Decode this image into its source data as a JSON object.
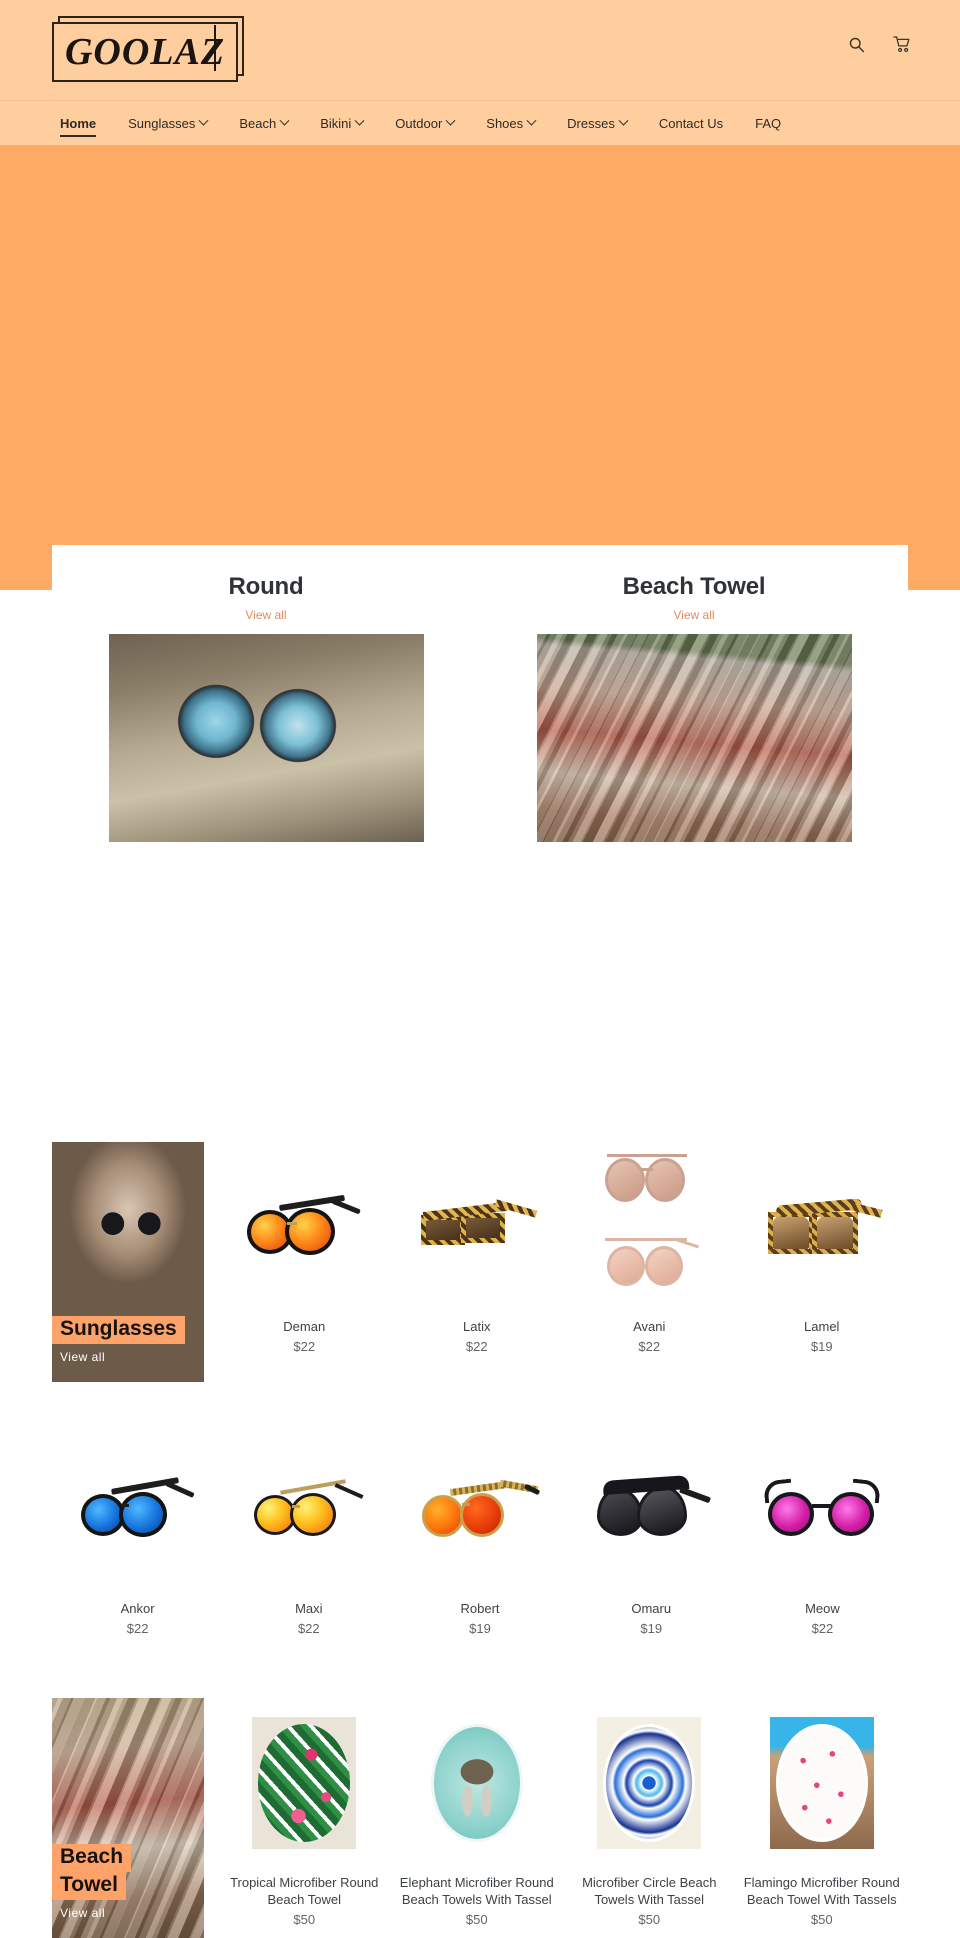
{
  "brand": {
    "logo_text": "GOOLAZ"
  },
  "header": {
    "search_icon": "search-icon",
    "cart_icon": "cart-icon"
  },
  "nav": {
    "items": [
      {
        "label": "Home",
        "has_dropdown": false,
        "active": true
      },
      {
        "label": "Sunglasses",
        "has_dropdown": true,
        "active": false
      },
      {
        "label": "Beach",
        "has_dropdown": true,
        "active": false
      },
      {
        "label": "Bikini",
        "has_dropdown": true,
        "active": false
      },
      {
        "label": "Outdoor",
        "has_dropdown": true,
        "active": false
      },
      {
        "label": "Shoes",
        "has_dropdown": true,
        "active": false
      },
      {
        "label": "Dresses",
        "has_dropdown": true,
        "active": false
      },
      {
        "label": "Contact Us",
        "has_dropdown": false,
        "active": false
      },
      {
        "label": "FAQ",
        "has_dropdown": false,
        "active": false
      }
    ]
  },
  "featured": {
    "columns": [
      {
        "title": "Round",
        "view_all": "View all"
      },
      {
        "title": "Beach Towel",
        "view_all": "View all"
      }
    ]
  },
  "collections": [
    {
      "tile": {
        "title": "Sunglasses",
        "title_lines": [
          "Sunglasses"
        ],
        "view_all": "View all"
      },
      "products": [
        {
          "name": "Deman",
          "price": "$22"
        },
        {
          "name": "Latix",
          "price": "$22"
        },
        {
          "name": "Avani",
          "price": "$22"
        },
        {
          "name": "Lamel",
          "price": "$19"
        }
      ]
    },
    {
      "products": [
        {
          "name": "Ankor",
          "price": "$22"
        },
        {
          "name": "Maxi",
          "price": "$22"
        },
        {
          "name": "Robert",
          "price": "$19"
        },
        {
          "name": "Omaru",
          "price": "$19"
        },
        {
          "name": "Meow",
          "price": "$22"
        }
      ]
    },
    {
      "tile": {
        "title": "Beach Towel",
        "title_lines": [
          "Beach",
          "Towel"
        ],
        "view_all": "View all"
      },
      "products": [
        {
          "name": "Tropical Microfiber Round Beach Towel",
          "price": "$50"
        },
        {
          "name": "Elephant Microfiber Round Beach Towels With Tassel",
          "price": "$50"
        },
        {
          "name": "Microfiber Circle Beach Towels With Tassel",
          "price": "$50"
        },
        {
          "name": "Flamingo Microfiber Round Beach Towel With Tassels",
          "price": "$50"
        }
      ]
    }
  ],
  "colors": {
    "header_bg": "#ffce9e",
    "hero_bg": "#ffab66",
    "accent": "#e08b60",
    "tile_highlight": "#fda36a",
    "text": "#3d4246"
  }
}
